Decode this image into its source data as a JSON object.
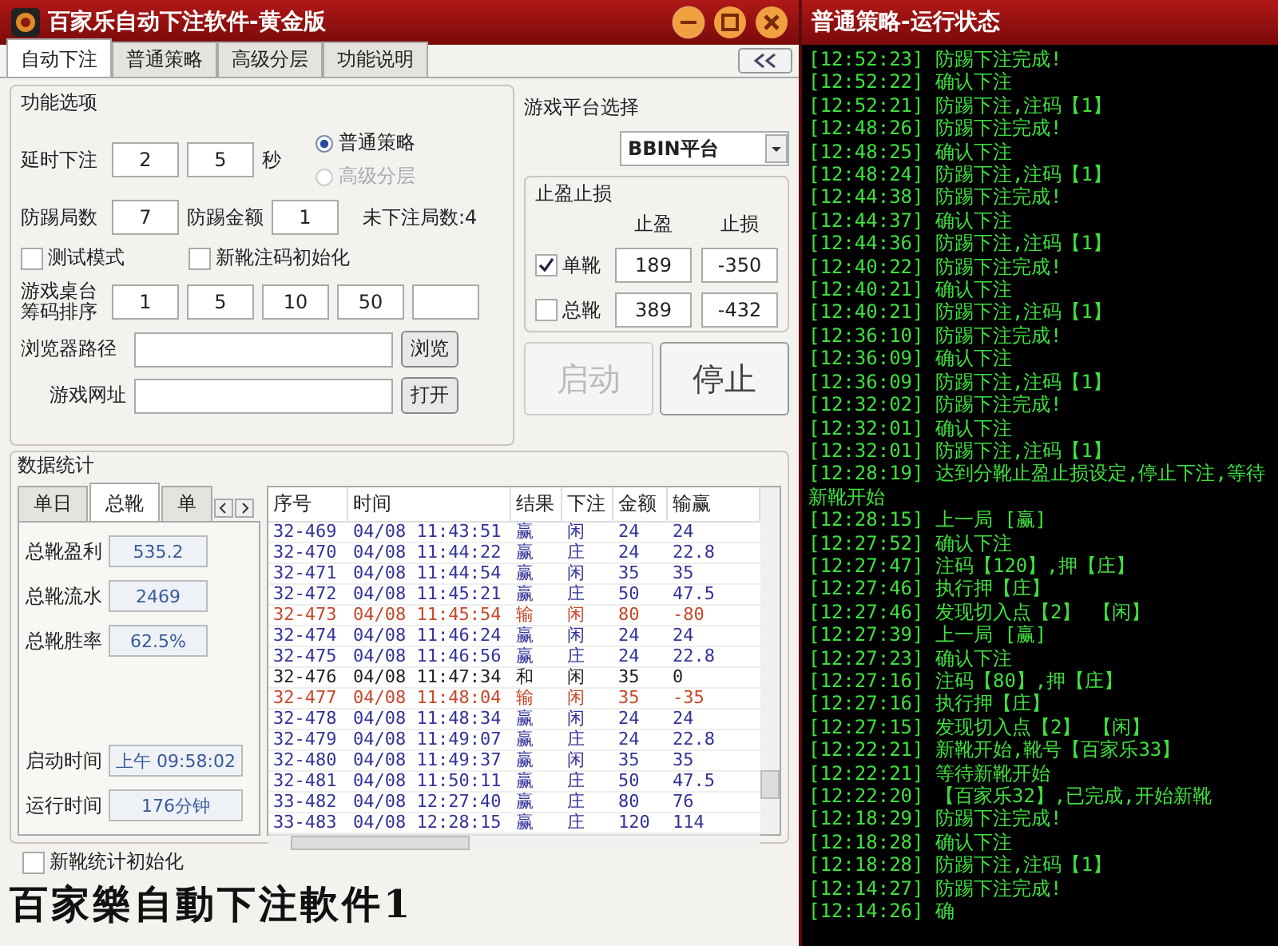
{
  "main_window": {
    "title": "百家乐自动下注软件-黄金版"
  },
  "tabs": [
    {
      "label": "自动下注",
      "selected": true
    },
    {
      "label": "普通策略",
      "selected": false
    },
    {
      "label": "高级分层",
      "selected": false
    },
    {
      "label": "功能说明",
      "selected": false
    }
  ],
  "options": {
    "title": "功能选项",
    "delay": {
      "label": "延时下注",
      "values": [
        "2",
        "5"
      ],
      "unit": "秒"
    },
    "strategy": [
      {
        "label": "普通策略",
        "selected": true,
        "disabled": false
      },
      {
        "label": "高级分层",
        "selected": false,
        "disabled": true
      }
    ],
    "kick_rounds": {
      "label": "防踢局数",
      "value": "7"
    },
    "kick_amount": {
      "label": "防踢金额",
      "value": "1"
    },
    "pending": "未下注局数:4",
    "checkboxes": [
      {
        "label": "测试模式",
        "checked": false
      },
      {
        "label": "新靴注码初始化",
        "checked": false
      }
    ],
    "chips": {
      "label": "游戏桌台筹码排序",
      "values": [
        "1",
        "5",
        "10",
        "50"
      ]
    },
    "browser_path": {
      "label": "浏览器路径",
      "button": "浏览"
    },
    "game_url": {
      "label": "游戏网址",
      "button": "打开"
    }
  },
  "platform": {
    "label": "游戏平台选择",
    "value": "BBIN平台"
  },
  "stop_limits": {
    "title": "止盈止损",
    "columns": [
      "止盈",
      "止损"
    ],
    "rows": [
      {
        "label": "单靴",
        "checked": true,
        "values": [
          "189",
          "-350"
        ]
      },
      {
        "label": "总靴",
        "checked": false,
        "values": [
          "389",
          "-432"
        ]
      }
    ]
  },
  "actions": [
    {
      "label": "启动",
      "disabled": true
    },
    {
      "label": "停止",
      "disabled": false
    }
  ],
  "stats": {
    "title": "数据统计",
    "tabs": [
      {
        "label": "单日",
        "selected": false
      },
      {
        "label": "总靴",
        "selected": true
      },
      {
        "label": "单",
        "selected": false
      }
    ],
    "totals": [
      {
        "label": "总靴盈利",
        "value": "535.2"
      },
      {
        "label": "总靴流水",
        "value": "2469"
      },
      {
        "label": "总靴胜率",
        "value": "62.5%"
      }
    ],
    "times": [
      {
        "label": "启动时间",
        "value": "上午 09:58:02"
      },
      {
        "label": "运行时间",
        "value": "176分钟"
      }
    ],
    "reset": {
      "label": "新靴统计初始化",
      "checked": false
    }
  },
  "table": {
    "columns": [
      "序号",
      "时间",
      "结果",
      "下注",
      "金额",
      "输赢"
    ],
    "rows": [
      {
        "cells": [
          "32-469",
          "04/08 11:43:51",
          "赢",
          "闲",
          "24",
          "24"
        ],
        "color": "#33339a"
      },
      {
        "cells": [
          "32-470",
          "04/08 11:44:22",
          "赢",
          "庄",
          "24",
          "22.8"
        ],
        "color": "#33339a"
      },
      {
        "cells": [
          "32-471",
          "04/08 11:44:54",
          "赢",
          "闲",
          "35",
          "35"
        ],
        "color": "#33339a"
      },
      {
        "cells": [
          "32-472",
          "04/08 11:45:21",
          "赢",
          "庄",
          "50",
          "47.5"
        ],
        "color": "#33339a"
      },
      {
        "cells": [
          "32-473",
          "04/08 11:45:54",
          "输",
          "闲",
          "80",
          "-80"
        ],
        "color": "#c8482a"
      },
      {
        "cells": [
          "32-474",
          "04/08 11:46:24",
          "赢",
          "闲",
          "24",
          "24"
        ],
        "color": "#33339a"
      },
      {
        "cells": [
          "32-475",
          "04/08 11:46:56",
          "赢",
          "庄",
          "24",
          "22.8"
        ],
        "color": "#33339a"
      },
      {
        "cells": [
          "32-476",
          "04/08 11:47:34",
          "和",
          "闲",
          "35",
          "0"
        ],
        "color": "#222222"
      },
      {
        "cells": [
          "32-477",
          "04/08 11:48:04",
          "输",
          "闲",
          "35",
          "-35"
        ],
        "color": "#c8482a"
      },
      {
        "cells": [
          "32-478",
          "04/08 11:48:34",
          "赢",
          "闲",
          "24",
          "24"
        ],
        "color": "#33339a"
      },
      {
        "cells": [
          "32-479",
          "04/08 11:49:07",
          "赢",
          "庄",
          "24",
          "22.8"
        ],
        "color": "#33339a"
      },
      {
        "cells": [
          "32-480",
          "04/08 11:49:37",
          "赢",
          "闲",
          "35",
          "35"
        ],
        "color": "#33339a"
      },
      {
        "cells": [
          "32-481",
          "04/08 11:50:11",
          "赢",
          "庄",
          "50",
          "47.5"
        ],
        "color": "#33339a"
      },
      {
        "cells": [
          "33-482",
          "04/08 12:27:40",
          "赢",
          "庄",
          "80",
          "76"
        ],
        "color": "#33339a"
      },
      {
        "cells": [
          "33-483",
          "04/08 12:28:15",
          "赢",
          "庄",
          "120",
          "114"
        ],
        "color": "#33339a"
      }
    ]
  },
  "caption": "百家樂自動下注軟件1",
  "log_window": {
    "title": "普通策略-运行状态",
    "entries": [
      {
        "time": "[12:52:23]",
        "text": "防踢下注完成!"
      },
      {
        "time": "[12:52:22]",
        "text": "确认下注"
      },
      {
        "time": "[12:52:21]",
        "text": "防踢下注,注码【1】"
      },
      {
        "time": "[12:48:26]",
        "text": "防踢下注完成!"
      },
      {
        "time": "[12:48:25]",
        "text": "确认下注"
      },
      {
        "time": "[12:48:24]",
        "text": "防踢下注,注码【1】"
      },
      {
        "time": "[12:44:38]",
        "text": "防踢下注完成!"
      },
      {
        "time": "[12:44:37]",
        "text": "确认下注"
      },
      {
        "time": "[12:44:36]",
        "text": "防踢下注,注码【1】"
      },
      {
        "time": "[12:40:22]",
        "text": "防踢下注完成!"
      },
      {
        "time": "[12:40:21]",
        "text": "确认下注"
      },
      {
        "time": "[12:40:21]",
        "text": "防踢下注,注码【1】"
      },
      {
        "time": "[12:36:10]",
        "text": "防踢下注完成!"
      },
      {
        "time": "[12:36:09]",
        "text": "确认下注"
      },
      {
        "time": "[12:36:09]",
        "text": "防踢下注,注码【1】"
      },
      {
        "time": "[12:32:02]",
        "text": "防踢下注完成!"
      },
      {
        "time": "[12:32:01]",
        "text": "确认下注"
      },
      {
        "time": "[12:32:01]",
        "text": "防踢下注,注码【1】"
      },
      {
        "time": "[12:28:19]",
        "text": "达到分靴止盈止损设定,停止下注,等待新靴开始"
      },
      {
        "time": "[12:28:15]",
        "text": "上一局 [赢]"
      },
      {
        "time": "[12:27:52]",
        "text": "确认下注"
      },
      {
        "time": "[12:27:47]",
        "text": "注码【120】,押【庄】"
      },
      {
        "time": "[12:27:46]",
        "text": "执行押【庄】"
      },
      {
        "time": "[12:27:46]",
        "text": "发现切入点【2】 【闲】"
      },
      {
        "time": "[12:27:39]",
        "text": "上一局 [赢]"
      },
      {
        "time": "[12:27:23]",
        "text": "确认下注"
      },
      {
        "time": "[12:27:16]",
        "text": "注码【80】,押【庄】"
      },
      {
        "time": "[12:27:16]",
        "text": "执行押【庄】"
      },
      {
        "time": "[12:27:15]",
        "text": "发现切入点【2】 【闲】"
      },
      {
        "time": "[12:22:21]",
        "text": "新靴开始,靴号【百家乐33】"
      },
      {
        "time": "[12:22:21]",
        "text": "等待新靴开始"
      },
      {
        "time": "[12:22:20]",
        "text": "【百家乐32】,已完成,开始新靴"
      },
      {
        "time": "[12:18:29]",
        "text": "防踢下注完成!"
      },
      {
        "time": "[12:18:28]",
        "text": "确认下注"
      },
      {
        "time": "[12:18:28]",
        "text": "防踢下注,注码【1】"
      },
      {
        "time": "[12:14:27]",
        "text": "防踢下注完成!"
      },
      {
        "time": "[12:14:26]",
        "text": "确"
      }
    ]
  }
}
